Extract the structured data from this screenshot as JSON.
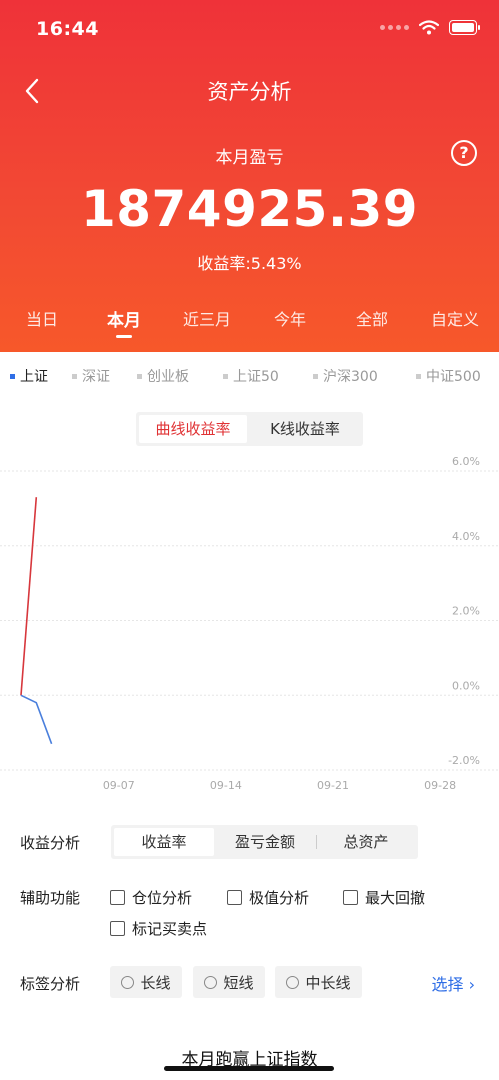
{
  "status_bar": {
    "time": "16:44"
  },
  "nav": {
    "title": "资产分析"
  },
  "summary": {
    "label": "本月盈亏",
    "value": "1874925.39",
    "yield_text": "收益率:5.43%"
  },
  "period_tabs": [
    {
      "label": "当日",
      "active": false
    },
    {
      "label": "本月",
      "active": true
    },
    {
      "label": "近三月",
      "active": false
    },
    {
      "label": "今年",
      "active": false
    },
    {
      "label": "全部",
      "active": false
    },
    {
      "label": "自定义",
      "active": false
    }
  ],
  "index_tabs": [
    {
      "label": "上证",
      "active": true
    },
    {
      "label": "深证",
      "active": false
    },
    {
      "label": "创业板",
      "active": false
    },
    {
      "label": "上证50",
      "active": false
    },
    {
      "label": "沪深300",
      "active": false
    },
    {
      "label": "中证500",
      "active": false
    }
  ],
  "chart_mode": {
    "options": [
      "曲线收益率",
      "K线收益率"
    ],
    "selected": "曲线收益率",
    "accent_color": "#e03234"
  },
  "chart_data": {
    "type": "line",
    "x_ticks": [
      "09-07",
      "09-14",
      "09-21",
      "09-28"
    ],
    "y_ticks": [
      "6.0%",
      "4.0%",
      "2.0%",
      "0.0%",
      "-2.0%"
    ],
    "ylim": [
      -2.0,
      6.0
    ],
    "grid": true,
    "series": [
      {
        "color": "#d7373c",
        "x": [
          "09-01",
          "09-02"
        ],
        "y": [
          0.0,
          5.3
        ]
      },
      {
        "color": "#4a7fdc",
        "x": [
          "09-01",
          "09-02",
          "09-03"
        ],
        "y": [
          0.0,
          -0.2,
          -1.3
        ]
      }
    ]
  },
  "analysis": {
    "label": "收益分析",
    "options": [
      "收益率",
      "盈亏金额",
      "总资产"
    ],
    "selected": "收益率"
  },
  "aux": {
    "label": "辅助功能",
    "checkboxes": [
      "仓位分析",
      "极值分析",
      "最大回撤",
      "标记买卖点"
    ]
  },
  "tags": {
    "label": "标签分析",
    "options": [
      "长线",
      "短线",
      "中长线"
    ],
    "select_link": "选择 ›"
  },
  "bottom_title": "本月跑赢上证指数"
}
